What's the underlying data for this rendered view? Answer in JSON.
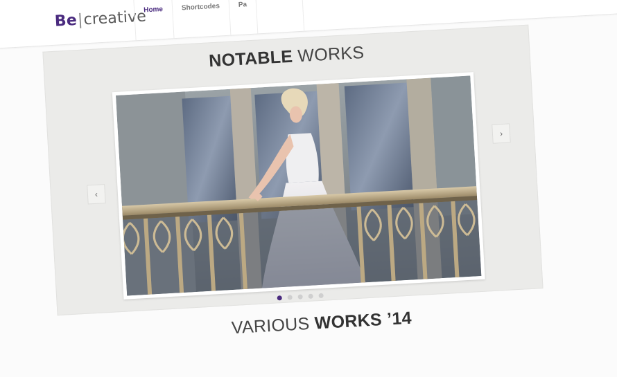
{
  "header": {
    "logo": {
      "be": "Be",
      "divider": "|",
      "rest": "creative"
    },
    "nav": [
      {
        "label": "Home",
        "active": true
      },
      {
        "label": "Shortcodes",
        "active": false
      },
      {
        "label": "Pa",
        "active": false
      },
      {
        "label": "",
        "active": false
      }
    ]
  },
  "slider": {
    "title_bold": "NOTABLE",
    "title_light": "WORKS",
    "prev_arrow": "‹",
    "next_arrow": "›",
    "slide_count": 5,
    "active_index": 0
  },
  "next_section": {
    "title_light": "VARIOUS",
    "title_bold": "WORKS",
    "title_year": "’14"
  },
  "colors": {
    "accent": "#4a2b7f",
    "panel": "#ebebe9",
    "page": "#fbfbfb"
  },
  "icons": {
    "prev": "chevron-left-icon",
    "next": "chevron-right-icon"
  }
}
